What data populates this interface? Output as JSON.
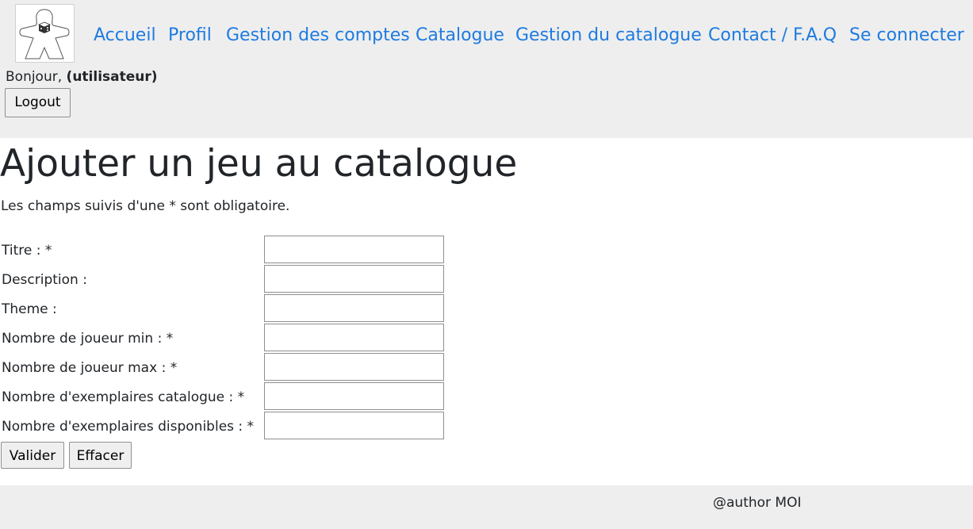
{
  "header": {
    "nav": [
      {
        "id": "accueil",
        "label": "Accueil"
      },
      {
        "id": "profil",
        "label": "Profil"
      },
      {
        "id": "gestion-comptes",
        "label": "Gestion des comptes"
      },
      {
        "id": "catalogue",
        "label": "Catalogue"
      },
      {
        "id": "gestion-catalogue",
        "label": "Gestion du catalogue"
      },
      {
        "id": "contact-faq",
        "label": "Contact / F.A.Q"
      },
      {
        "id": "se-connecter",
        "label": "Se connecter"
      }
    ],
    "greeting_prefix": "Bonjour,",
    "username": "(utilisateur)",
    "logout_label": "Logout",
    "logo_icon": "meeple-dice-icon"
  },
  "main": {
    "title": "Ajouter un jeu au catalogue",
    "subtitle": "Les champs suivis d'une * sont obligatoire.",
    "fields": [
      {
        "label": "Titre : *",
        "value": ""
      },
      {
        "label": "Description :",
        "value": ""
      },
      {
        "label": "Theme :",
        "value": ""
      },
      {
        "label": "Nombre de joueur min : *",
        "value": ""
      },
      {
        "label": "Nombre de joueur max : *",
        "value": ""
      },
      {
        "label": "Nombre d'exemplaires catalogue : *",
        "value": ""
      },
      {
        "label": "Nombre d'exemplaires disponibles : *",
        "value": ""
      }
    ],
    "submit_label": "Valider",
    "reset_label": "Effacer"
  },
  "footer": {
    "text": "@author MOI"
  },
  "colors": {
    "link": "#1e7be0",
    "header_bg": "#eeeeee",
    "text": "#212529"
  }
}
